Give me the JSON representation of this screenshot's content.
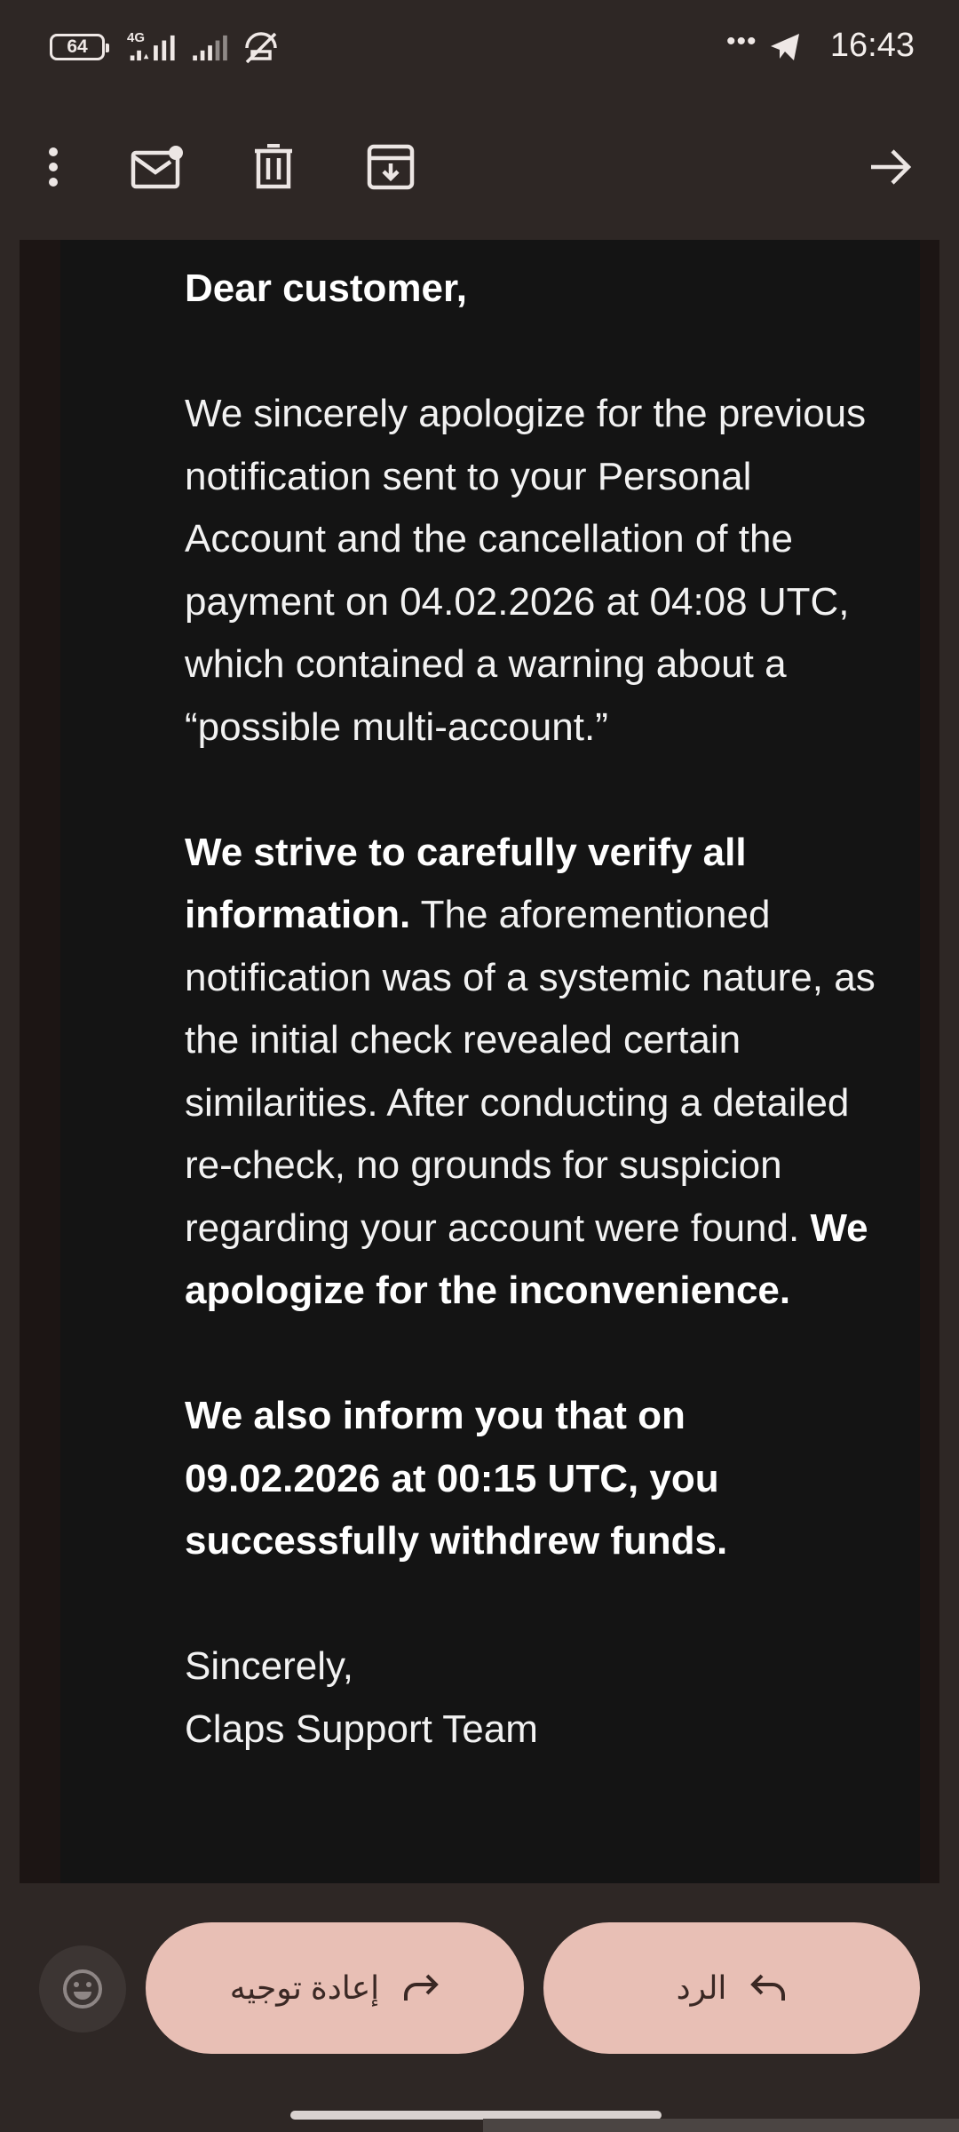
{
  "status_bar": {
    "battery": "64",
    "network": "4G",
    "time": "16:43",
    "icons": [
      "battery-icon",
      "signal-icon",
      "wifi-icon",
      "mute-icon",
      "more-dots-icon",
      "telegram-icon"
    ]
  },
  "toolbar": {
    "icons": [
      "more-vert-icon",
      "mark-unread-icon",
      "delete-icon",
      "archive-icon",
      "forward-arrow-icon"
    ]
  },
  "email": {
    "greeting": "Dear customer,",
    "para1": "We sincerely apologize for the previous notification sent to your Personal Account and the cancellation of the payment on 04.02.2026 at 04:08 UTC, which contained a warning about a “possible multi-account.”",
    "para2_bold_start": "We strive to carefully verify all information.",
    "para2_middle": " The aforementioned notification was of a systemic nature, as the initial check revealed certain similarities. After conducting a detailed re-check, no grounds for suspicion regarding your account were found. ",
    "para2_bold_end": "We apologize for the inconvenience.",
    "para3": "We also inform you that on 09.02.2026 at 00:15 UTC, you successfully withdrew funds.",
    "closing": "Sincerely,",
    "signature": "Claps Support Team"
  },
  "actions": {
    "forward_label": "إعادة توجيه",
    "reply_label": "الرد",
    "colors": {
      "pill": "#e8bfb5",
      "background": "#2e2725"
    }
  }
}
